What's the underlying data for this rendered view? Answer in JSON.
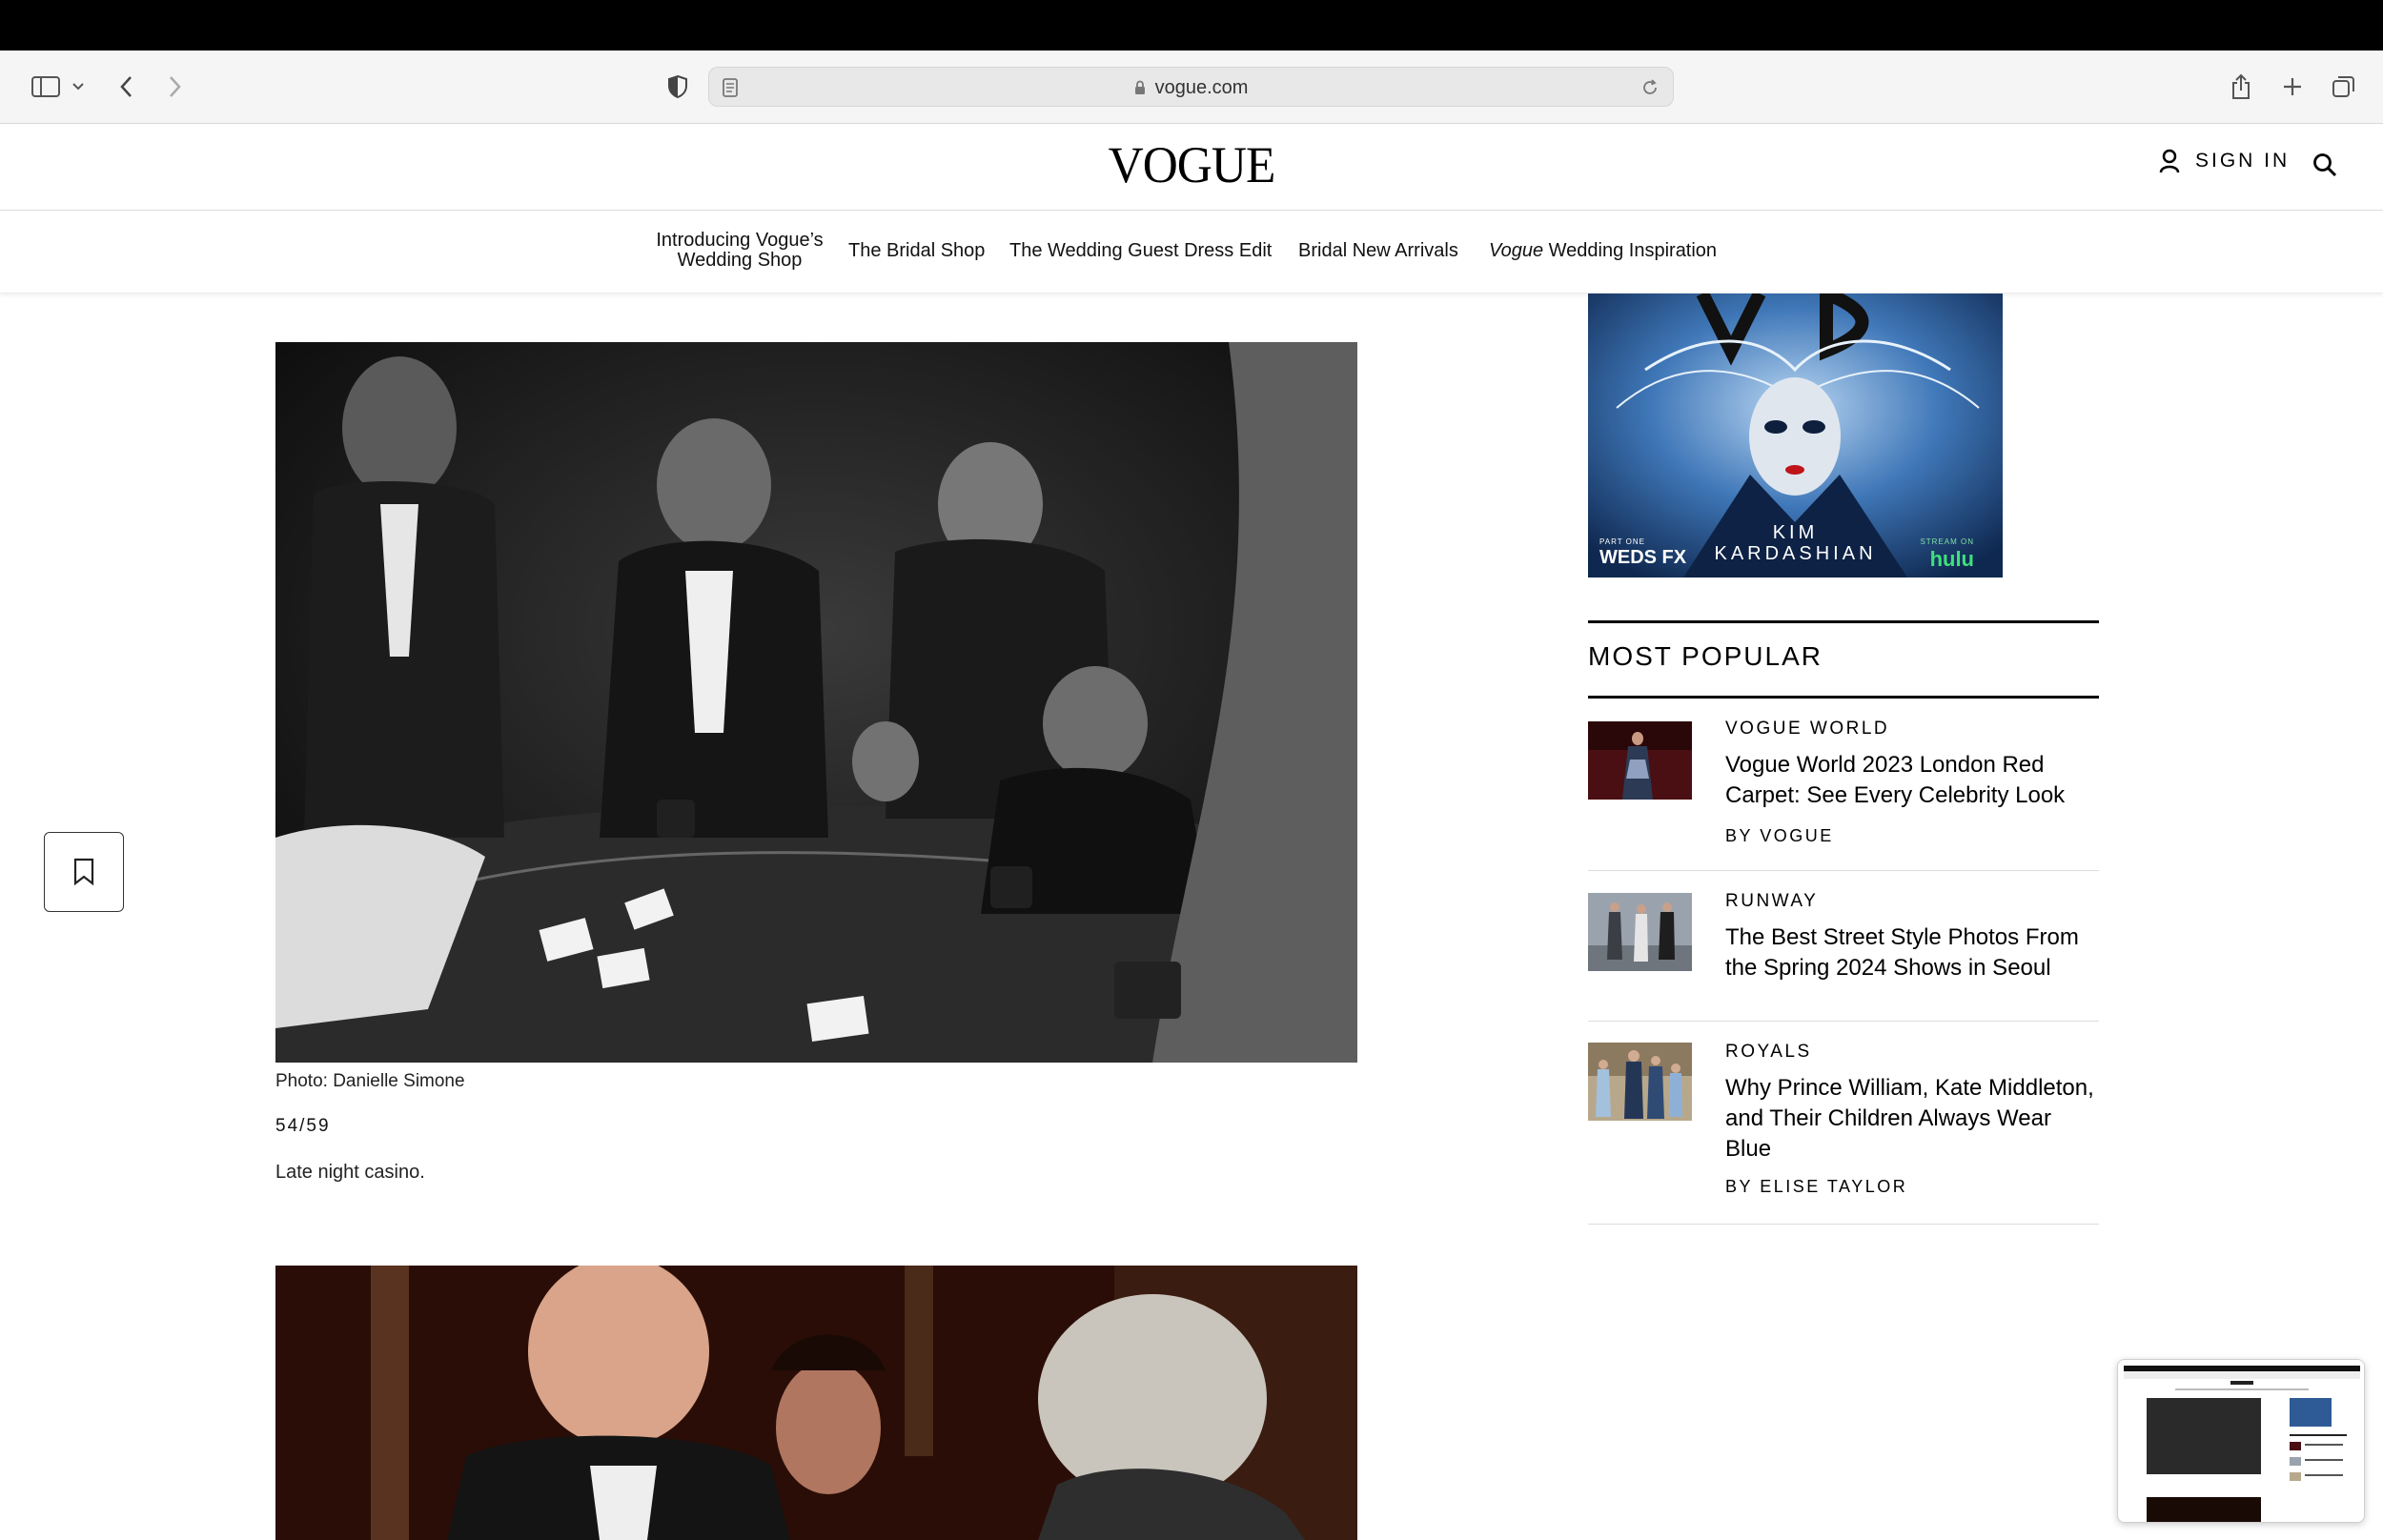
{
  "browser": {
    "url": "vogue.com"
  },
  "site": {
    "logo": "VOGUE",
    "sign_in": "SIGN IN"
  },
  "subnav": {
    "item1_line1": "Introducing Vogue’s",
    "item1_line2": "Wedding Shop",
    "item2": "The Bridal Shop",
    "item3": "The Wedding Guest Dress Edit",
    "item4": "Bridal New Arrivals",
    "item5_italic": "Vogue",
    "item5_rest": " Wedding Inspiration"
  },
  "gallery": {
    "photo_credit": "Photo: Danielle Simone",
    "counter": "54/59",
    "caption": "Late night casino."
  },
  "ad": {
    "line1": "KIM",
    "line2": "KARDASHIAN",
    "network_top": "PART ONE",
    "network": "WEDS FX",
    "stream_top": "STREAM ON",
    "stream": "hulu"
  },
  "most_popular": {
    "title": "MOST POPULAR",
    "items": [
      {
        "category": "VOGUE WORLD",
        "headline": "Vogue World 2023 London Red Carpet: See Every Celebrity Look",
        "byline": "BY VOGUE"
      },
      {
        "category": "RUNWAY",
        "headline": "The Best Street Style Photos From the Spring 2024 Shows in Seoul",
        "byline": ""
      },
      {
        "category": "ROYALS",
        "headline": "Why Prince William, Kate Middleton, and Their Children Always Wear Blue",
        "byline": "BY ELISE TAYLOR"
      }
    ]
  },
  "colors": {
    "ad_blue": "#1a3f7a",
    "text": "#000000"
  }
}
